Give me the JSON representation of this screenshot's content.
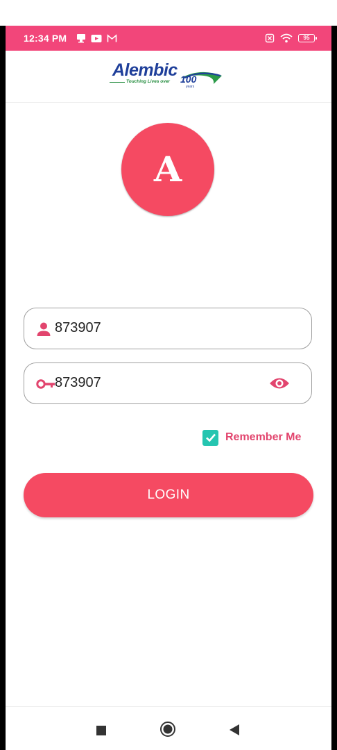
{
  "status_bar": {
    "time": "12:34 PM",
    "left_icons": [
      "monitor-icon",
      "youtube-icon",
      "gmail-icon"
    ],
    "right_icons": [
      "sim-icon",
      "wifi-icon",
      "battery-icon"
    ],
    "battery_level": "95",
    "color": "#f2467a"
  },
  "header": {
    "logo_name": "Alembic",
    "logo_tagline": "Touching Lives over",
    "logo_number": "100",
    "logo_years": "years"
  },
  "avatar": {
    "letter": "A",
    "color": "#f54a62"
  },
  "login_form": {
    "username_value": "873907",
    "username_icon": "person-icon",
    "password_value": "873907",
    "password_icon": "key-icon",
    "visibility_icon": "eye-icon",
    "remember_me_label": "Remember Me",
    "remember_me_checked": true,
    "login_button_label": "LOGIN",
    "accent_color": "#e2456e",
    "checkbox_color": "#25c5b0"
  },
  "nav_bar": {
    "items": [
      "recents-icon",
      "home-icon",
      "back-icon"
    ]
  }
}
